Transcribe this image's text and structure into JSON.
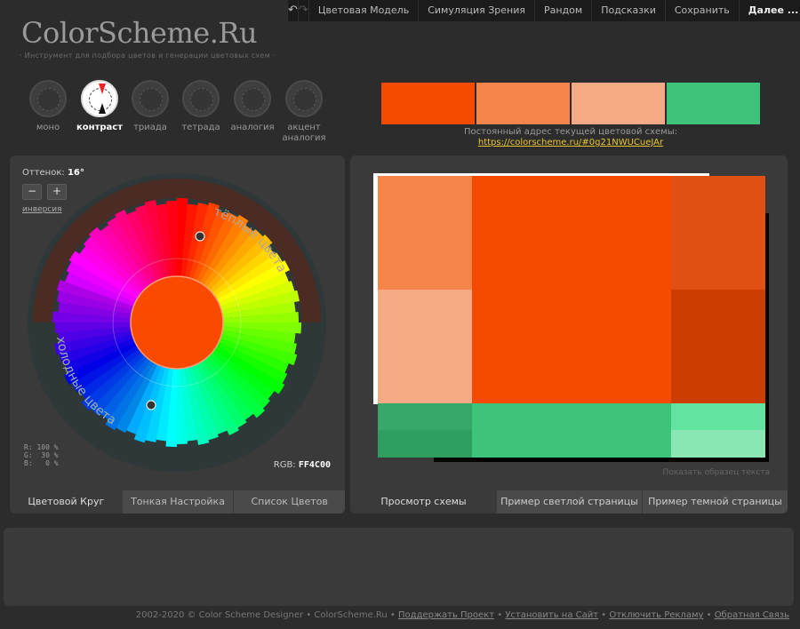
{
  "topmenu": {
    "undo_icon": "undo-icon",
    "redo_icon": "redo-icon",
    "items": [
      "Цветовая Модель",
      "Симуляция Зрения",
      "Рандом",
      "Подсказки",
      "Сохранить"
    ],
    "next": "Далее ..."
  },
  "logo": "ColorScheme.Ru",
  "tagline": "· Инструмент для подбора цветов и генерации цветовых схем ·",
  "modes": [
    {
      "label": "моно",
      "active": false
    },
    {
      "label": "контраст",
      "active": true
    },
    {
      "label": "триада",
      "active": false
    },
    {
      "label": "тетрада",
      "active": false
    },
    {
      "label": "аналогия",
      "active": false
    },
    {
      "label": "акцент аналогия",
      "active": false
    }
  ],
  "swatches": [
    "#f54b00",
    "#f5844a",
    "#f5aa85",
    "#3ec47a"
  ],
  "permalink": {
    "label": "Постоянный адрес текущей цветовой схемы:",
    "url": "https://colorscheme.ru/#0g21NWUCueJAr"
  },
  "left_panel": {
    "hue_label": "Оттенок:",
    "hue_value": "16°",
    "minus": "−",
    "plus": "+",
    "inversion": "инверсия",
    "warm_label": "тёплые цвета",
    "cold_label": "холодные цвета",
    "rgb_r": "R: 100 %",
    "rgb_g": "G:  30 %",
    "rgb_b": "B:   0 %",
    "rgb_label": "RGB:",
    "rgb_hex": "FF4C00",
    "tabs": [
      "Цветовой Круг",
      "Тонкая Настройка",
      "Список Цветов"
    ]
  },
  "right_panel": {
    "sample_text": "Показать образец текста",
    "tabs": [
      "Просмотр схемы",
      "Пример светлой страницы",
      "Пример темной страницы"
    ]
  },
  "footer": {
    "copyright": "2002-2020 © Color Scheme Designer • ColorScheme.Ru •",
    "links": [
      "Поддержать Проект",
      "Установить на Сайт",
      "Отключить Рекламу",
      "Обратная Связь"
    ]
  }
}
